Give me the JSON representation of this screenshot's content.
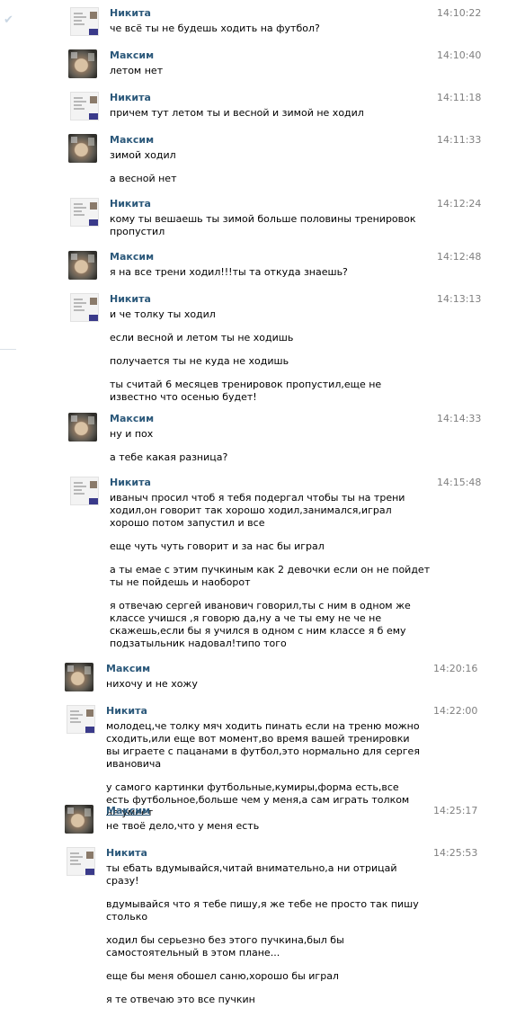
{
  "messages": [
    {
      "author": "Никита",
      "time": "14:10:22",
      "avatar": "nikita-avatar",
      "lines": [
        "че всё ты не будешь ходить на футбол?"
      ]
    },
    {
      "author": "Максим",
      "time": "14:10:40",
      "avatar": "maksim-avatar",
      "lines": [
        "летом нет"
      ]
    },
    {
      "author": "Никита",
      "time": "14:11:18",
      "avatar": "nikita-avatar",
      "lines": [
        "причем тут летом ты и весной и зимой не ходил"
      ]
    },
    {
      "author": "Максим",
      "time": "14:11:33",
      "avatar": "maksim-avatar",
      "lines": [
        "зимой ходил",
        "а весной нет"
      ]
    },
    {
      "author": "Никита",
      "time": "14:12:24",
      "avatar": "nikita-avatar",
      "lines": [
        "кому ты вешаешь ты зимой больше половины тренировок пропустил"
      ]
    },
    {
      "author": "Максим",
      "time": "14:12:48",
      "avatar": "maksim-avatar",
      "lines": [
        "я на все трени ходил!!!ты та откуда знаешь?"
      ]
    },
    {
      "author": "Никита",
      "time": "14:13:13",
      "avatar": "nikita-avatar",
      "lines": [
        "и че толку ты ходил",
        "если весной и летом ты не ходишь",
        "получается ты не куда не ходишь",
        "ты считай 6 месяцев тренировок пропустил,еще не известно что осенью будет!"
      ]
    },
    {
      "author": "Максим",
      "time": "14:14:33",
      "avatar": "maksim-avatar",
      "lines": [
        "ну и пох",
        "а тебе какая разница?"
      ]
    },
    {
      "author": "Никита",
      "time": "14:15:48",
      "avatar": "nikita-avatar",
      "lines": [
        "иваныч просил чтоб я тебя подергал чтобы ты на трени ходил,он говорит так хорошо ходил,занимался,играл хорошо потом запустил и все",
        "еще чуть чуть говорит и за нас бы играл",
        "а ты емае с этим пучкиным как 2 девочки если он не пойдет ты не пойдешь и наоборот",
        "я отвечаю сергей иванович говорил,ты с ним в одном же классе учишся ,я говорю да,ну а че ты ему не че не скажешь,если бы я учился в одном с ним классе я б ему подзатыльник надовал!типо того"
      ]
    },
    {
      "author": "Максим",
      "time": "14:20:16",
      "avatar": "maksim-avatar",
      "lines": [
        "нихочу и не хожу"
      ]
    },
    {
      "author": "Никита",
      "time": "14:22:00",
      "avatar": "nikita-avatar",
      "lines": [
        "молодец,че толку мяч ходить пинать если на треню можно сходить,или еще вот момент,во время вашей тренировки вы играете с пацанами в футбол,это нормально для сергея ивановича",
        "у самого картинки футбольные,кумиры,форма есть,все есть футбольное,больше чем у меня,а сам играть толком не умеет"
      ]
    },
    {
      "author": "Максим",
      "time": "14:25:17",
      "avatar": "maksim-avatar",
      "lines": [
        "не твоё дело,что у меня есть"
      ]
    },
    {
      "author": "Никита",
      "time": "14:25:53",
      "avatar": "nikita-avatar",
      "lines": [
        "ты ебать вдумывайся,читай внимательно,а ни отрицай сразу!",
        "вдумывайся что я тебе пишу,я же тебе не просто так пишу столько",
        "ходил бы серьезно без этого пучкина,был бы самостоятельный в этом плане...",
        "еще бы меня обошел саню,хорошо бы играл",
        "я те отвечаю это все пучкин"
      ]
    }
  ]
}
